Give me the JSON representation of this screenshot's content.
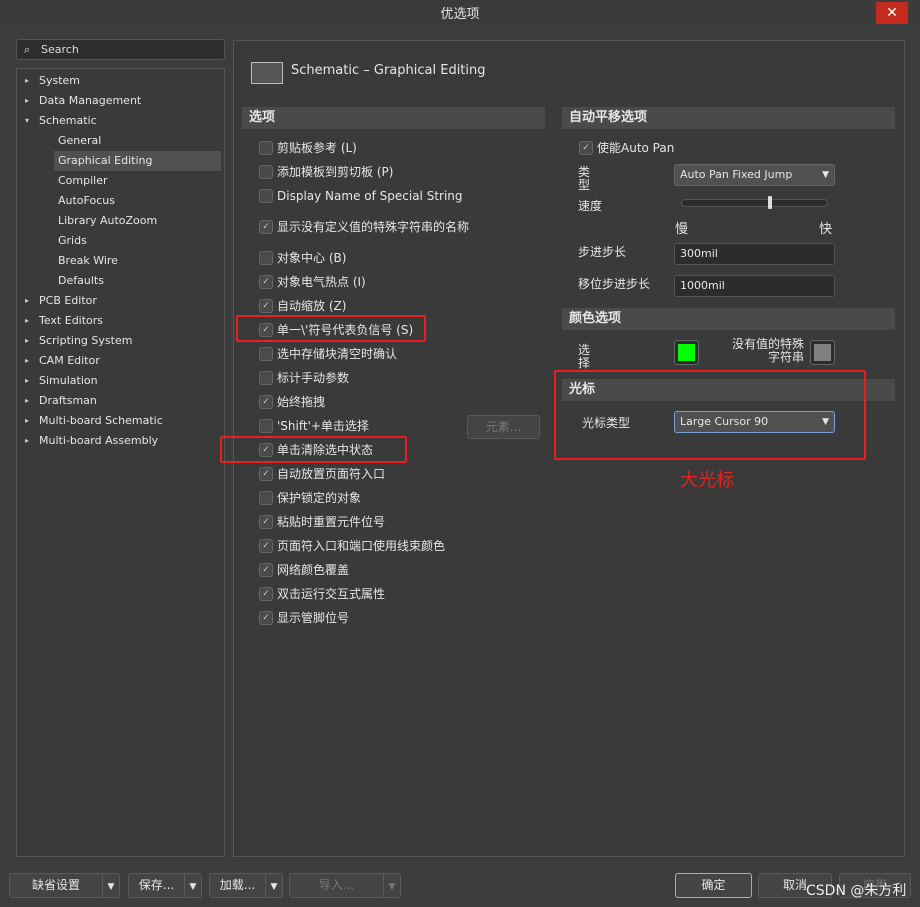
{
  "window": {
    "title": "优选项",
    "close": "✕"
  },
  "search": {
    "placeholder": "Search",
    "icon": "search-icon"
  },
  "tree": [
    {
      "label": "System",
      "level": 0,
      "arrow": "▸"
    },
    {
      "label": "Data Management",
      "level": 0,
      "arrow": "▸"
    },
    {
      "label": "Schematic",
      "level": 0,
      "arrow": "▾"
    },
    {
      "label": "General",
      "level": 1
    },
    {
      "label": "Graphical Editing",
      "level": 1,
      "selected": true
    },
    {
      "label": "Compiler",
      "level": 1
    },
    {
      "label": "AutoFocus",
      "level": 1
    },
    {
      "label": "Library AutoZoom",
      "level": 1
    },
    {
      "label": "Grids",
      "level": 1
    },
    {
      "label": "Break Wire",
      "level": 1
    },
    {
      "label": "Defaults",
      "level": 1
    },
    {
      "label": "PCB Editor",
      "level": 0,
      "arrow": "▸"
    },
    {
      "label": "Text Editors",
      "level": 0,
      "arrow": "▸"
    },
    {
      "label": "Scripting System",
      "level": 0,
      "arrow": "▸"
    },
    {
      "label": "CAM Editor",
      "level": 0,
      "arrow": "▸"
    },
    {
      "label": "Simulation",
      "level": 0,
      "arrow": "▸"
    },
    {
      "label": "Draftsman",
      "level": 0,
      "arrow": "▸"
    },
    {
      "label": "Multi-board Schematic",
      "level": 0,
      "arrow": "▸"
    },
    {
      "label": "Multi-board Assembly",
      "level": 0,
      "arrow": "▸"
    }
  ],
  "page": {
    "title": "Schematic – Graphical Editing"
  },
  "options": {
    "header": "选项",
    "items": [
      {
        "label": "剪贴板参考 (L)",
        "checked": false
      },
      {
        "label": "添加模板到剪切板 (P)",
        "checked": false
      },
      {
        "label": "Display Name of Special String",
        "checked": false
      },
      {
        "label": "显示没有定义值的特殊字符串的名称",
        "checked": true
      },
      {
        "label": "对象中心 (B)",
        "checked": false
      },
      {
        "label": "对象电气热点 (I)",
        "checked": true
      },
      {
        "label": "自动缩放 (Z)",
        "checked": true
      },
      {
        "label": "单一\\'符号代表负信号 (S)",
        "checked": true
      },
      {
        "label": "选中存储块清空时确认",
        "checked": false
      },
      {
        "label": "标计手动参数",
        "checked": false
      },
      {
        "label": "始终拖拽",
        "checked": true
      },
      {
        "label": "'Shift'+单击选择",
        "checked": false
      },
      {
        "label": "单击清除选中状态",
        "checked": true
      },
      {
        "label": "自动放置页面符入口",
        "checked": true
      },
      {
        "label": "保护锁定的对象",
        "checked": false
      },
      {
        "label": "粘贴时重置元件位号",
        "checked": true
      },
      {
        "label": "页面符入口和端口使用线束颜色",
        "checked": true
      },
      {
        "label": "网络颜色覆盖",
        "checked": true
      },
      {
        "label": "双击运行交互式属性",
        "checked": true
      },
      {
        "label": "显示管脚位号",
        "checked": true
      }
    ],
    "elements_button": "元素..."
  },
  "autopan": {
    "header": "自动平移选项",
    "enable_label": "使能Auto Pan",
    "enabled": true,
    "type_label": "类型",
    "type_value": "Auto Pan Fixed Jump",
    "speed_label": "速度",
    "speed_fraction": 0.6,
    "slow": "慢",
    "fast": "快",
    "step_label": "步进步长",
    "step_value": "300mil",
    "shift_step_label": "移位步进步长",
    "shift_step_value": "1000mil"
  },
  "colors": {
    "header": "颜色选项",
    "selection_label": "选择",
    "selection_color": "#00ff00",
    "novalue_label": "没有值的特殊字符串",
    "novalue_color": "#808080"
  },
  "cursor": {
    "header": "光标",
    "type_label": "光标类型",
    "type_value": "Large Cursor 90",
    "annotation": "大光标"
  },
  "footer": {
    "defaults": "缺省设置",
    "save": "保存...",
    "load": "加载...",
    "import": "导入...",
    "ok": "确定",
    "cancel": "取消",
    "apply": "应用",
    "watermark": "CSDN @朱方利"
  }
}
